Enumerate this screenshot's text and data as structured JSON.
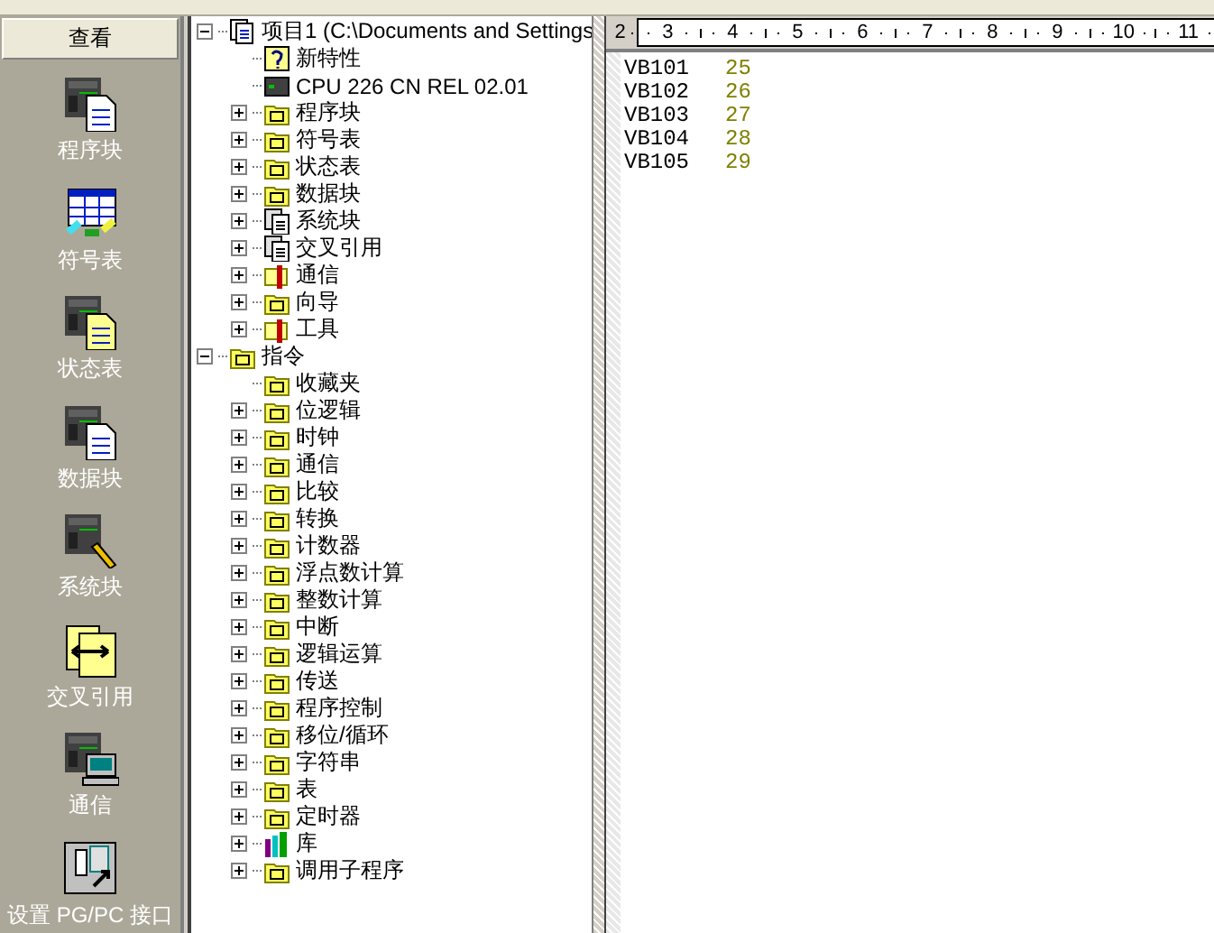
{
  "navigation_bar": {
    "header": "查看",
    "items": [
      {
        "label": "程序块",
        "kind": "program"
      },
      {
        "label": "符号表",
        "kind": "symbols"
      },
      {
        "label": "状态表",
        "kind": "status"
      },
      {
        "label": "数据块",
        "kind": "data"
      },
      {
        "label": "系统块",
        "kind": "system"
      },
      {
        "label": "交叉引用",
        "kind": "crossref"
      },
      {
        "label": "通信",
        "kind": "comm"
      },
      {
        "label": "设置 PG/PC 接口",
        "kind": "setup"
      }
    ]
  },
  "tree": [
    {
      "label": "项目1 (C:\\Documents and Settings",
      "kind": "branch",
      "expanded": true,
      "children": [
        {
          "label": "新特性",
          "kind": "leaf"
        },
        {
          "label": "CPU 226 CN REL 02.01",
          "kind": "leaf"
        },
        {
          "label": "程序块",
          "kind": "branch",
          "expanded": false
        },
        {
          "label": "符号表",
          "kind": "branch",
          "expanded": false
        },
        {
          "label": "状态表",
          "kind": "branch",
          "expanded": false
        },
        {
          "label": "数据块",
          "kind": "branch",
          "expanded": false
        },
        {
          "label": "系统块",
          "kind": "branch",
          "expanded": false
        },
        {
          "label": "交叉引用",
          "kind": "branch",
          "expanded": false
        },
        {
          "label": "通信",
          "kind": "branch",
          "expanded": false
        },
        {
          "label": "向导",
          "kind": "branch",
          "expanded": false
        },
        {
          "label": "工具",
          "kind": "branch",
          "expanded": false
        }
      ]
    },
    {
      "label": "指令",
      "kind": "branch",
      "expanded": true,
      "children": [
        {
          "label": "收藏夹",
          "kind": "leaf"
        },
        {
          "label": "位逻辑",
          "kind": "branch",
          "expanded": false
        },
        {
          "label": "时钟",
          "kind": "branch",
          "expanded": false
        },
        {
          "label": "通信",
          "kind": "branch",
          "expanded": false
        },
        {
          "label": "比较",
          "kind": "branch",
          "expanded": false
        },
        {
          "label": "转换",
          "kind": "branch",
          "expanded": false
        },
        {
          "label": "计数器",
          "kind": "branch",
          "expanded": false
        },
        {
          "label": "浮点数计算",
          "kind": "branch",
          "expanded": false
        },
        {
          "label": "整数计算",
          "kind": "branch",
          "expanded": false
        },
        {
          "label": "中断",
          "kind": "branch",
          "expanded": false
        },
        {
          "label": "逻辑运算",
          "kind": "branch",
          "expanded": false
        },
        {
          "label": "传送",
          "kind": "branch",
          "expanded": false
        },
        {
          "label": "程序控制",
          "kind": "branch",
          "expanded": false
        },
        {
          "label": "移位/循环",
          "kind": "branch",
          "expanded": false
        },
        {
          "label": "字符串",
          "kind": "branch",
          "expanded": false
        },
        {
          "label": "表",
          "kind": "branch",
          "expanded": false
        },
        {
          "label": "定时器",
          "kind": "branch",
          "expanded": false
        },
        {
          "label": "库",
          "kind": "branch",
          "expanded": false
        },
        {
          "label": "调用子程序",
          "kind": "branch",
          "expanded": false
        }
      ]
    }
  ],
  "ruler": {
    "numbers": [
      "2",
      "3",
      "4",
      "5",
      "6",
      "7",
      "8",
      "9",
      "10",
      "11"
    ]
  },
  "editor": {
    "rows": [
      {
        "address": "VB101",
        "value": "25"
      },
      {
        "address": "VB102",
        "value": "26"
      },
      {
        "address": "VB103",
        "value": "27"
      },
      {
        "address": "VB104",
        "value": "28"
      },
      {
        "address": "VB105",
        "value": "29"
      }
    ]
  }
}
